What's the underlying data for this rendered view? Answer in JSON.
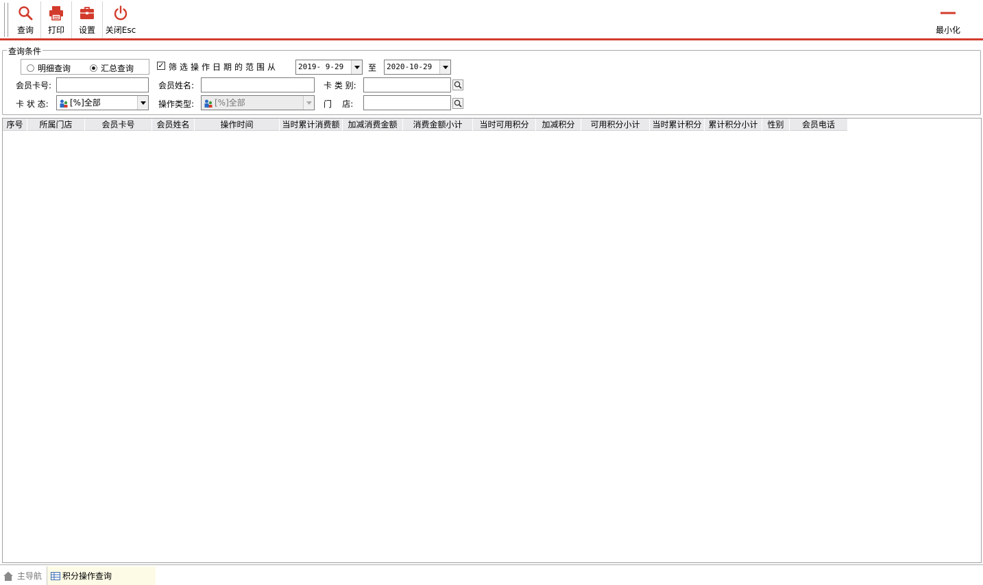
{
  "toolbar": {
    "buttons": [
      {
        "label": "查询",
        "icon": "search-icon"
      },
      {
        "label": "打印",
        "icon": "printer-icon"
      },
      {
        "label": "设置",
        "icon": "toolbox-icon"
      },
      {
        "label": "关闭Esc",
        "icon": "power-icon"
      }
    ],
    "minimize_label": "最小化",
    "accent_color": "#d23b2c"
  },
  "query": {
    "group_title": "查询条件",
    "radio_detail": "明细查询",
    "radio_summary": "汇总查询",
    "selected_mode": "汇总查询",
    "filter_checked": true,
    "filter_label": "筛选操作日期的范围从",
    "date_from": "2019- 9-29",
    "to_label": "至",
    "date_to": "2020-10-29",
    "card_no_label": "会员卡号:",
    "card_no_value": "",
    "member_name_label": "会员姓名:",
    "member_name_value": "",
    "card_type_label": "卡 类 别:",
    "card_type_value": "",
    "card_status_label": "卡 状 态:",
    "card_status_value": "[%]全部",
    "op_type_label": "操作类型:",
    "op_type_value": "[%]全部",
    "store_label": "门    店:",
    "store_value": ""
  },
  "grid": {
    "columns": [
      "序号",
      "所属门店",
      "会员卡号",
      "会员姓名",
      "操作时间",
      "当时累计消费额",
      "加减消费金额",
      "消费金额小计",
      "当时可用积分",
      "加减积分",
      "可用积分小计",
      "当时累计积分",
      "累计积分小计",
      "性别",
      "会员电话"
    ],
    "rows": []
  },
  "tabs": {
    "home": "主导航",
    "active": "积分操作查询"
  }
}
